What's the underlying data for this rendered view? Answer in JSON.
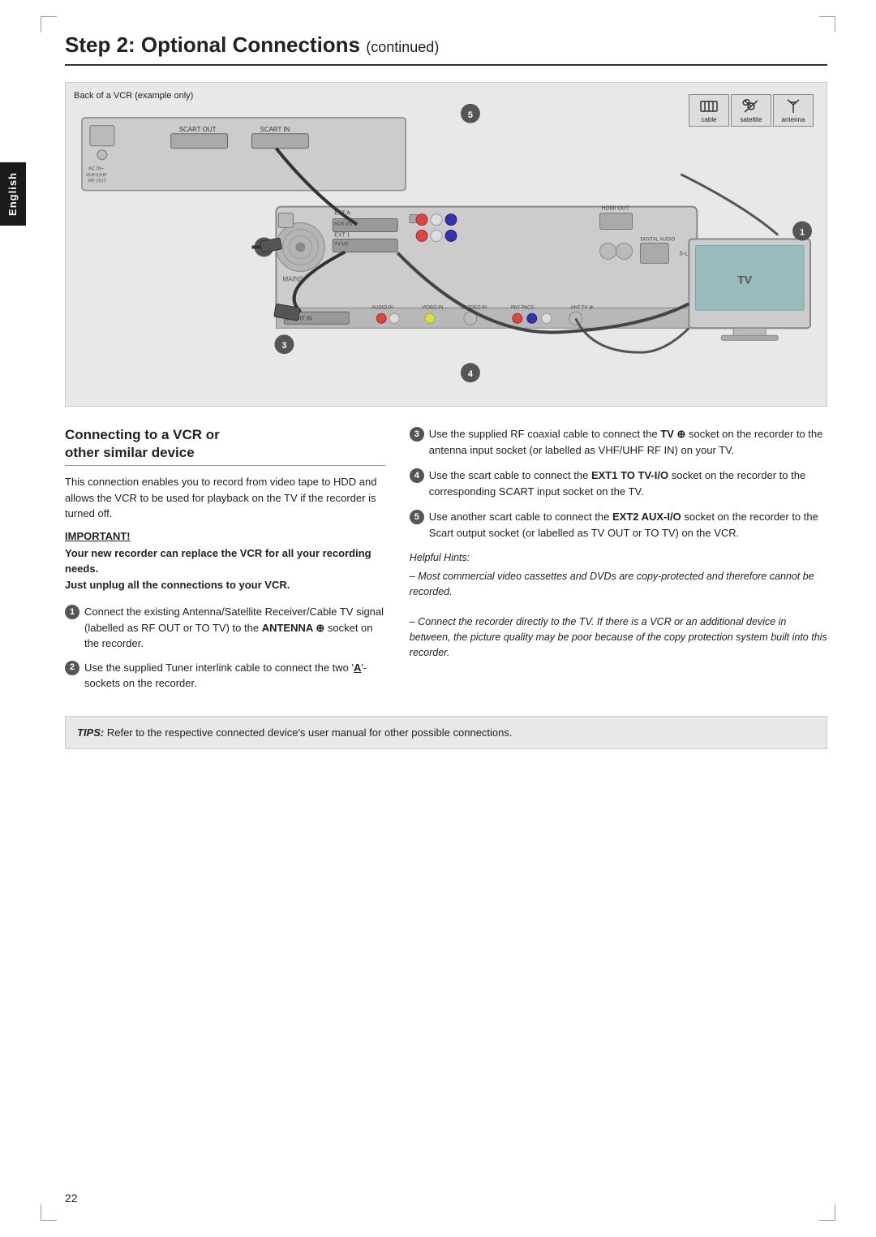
{
  "page": {
    "number": "22",
    "title": "Step 2: Optional Connections",
    "title_continued": "continued"
  },
  "english_tab": "English",
  "diagram": {
    "label": "Back of a VCR (example only)",
    "step_numbers": [
      "1",
      "2",
      "3",
      "4",
      "5"
    ],
    "icon_labels": [
      "cable",
      "satellite",
      "antenna"
    ]
  },
  "section": {
    "heading_line1": "Connecting to a VCR or",
    "heading_line2": "other similar device",
    "intro_text": "This connection enables you to record from video tape to HDD and allows the VCR to be used for playback on the TV if the recorder is turned off.",
    "important_label": "IMPORTANT!",
    "important_bold1": "Your new recorder can replace the VCR for all your recording needs.",
    "important_bold2": "Just unplug all the connections to your VCR.",
    "left_list": [
      {
        "number": "1",
        "text_before": "Connect the existing Antenna/Satellite Receiver/Cable TV signal (labelled as RF OUT or TO TV) to the ",
        "bold": "ANTENNA ⊕",
        "text_after": " socket on the recorder."
      },
      {
        "number": "2",
        "text_before": "Use the supplied Tuner interlink cable to connect the two '",
        "bold_char": "A",
        "text_after": "'-sockets on the recorder."
      }
    ],
    "right_list": [
      {
        "number": "3",
        "text": "Use the supplied RF coaxial cable to connect the ",
        "bold": "TV ⊕",
        "text2": " socket on the recorder to the antenna input socket (or labelled as VHF/UHF RF IN) on your TV."
      },
      {
        "number": "4",
        "text": "Use the scart cable to connect the ",
        "bold": "EXT1 TO TV-I/O",
        "text2": " socket on the recorder to the corresponding SCART input socket on the TV."
      },
      {
        "number": "5",
        "text": "Use another scart cable to connect the ",
        "bold": "EXT2 AUX-I/O",
        "text2": " socket on the recorder to the Scart output socket (or labelled as TV OUT or TO TV) on the VCR."
      }
    ],
    "helpful_hints_title": "Helpful Hints:",
    "hint1": "– Most commercial video cassettes and DVDs are copy-protected and therefore cannot be recorded.",
    "hint2": "– Connect the recorder directly to the TV. If there is a VCR or an additional device in between, the picture quality may be poor because of the copy protection system built into this recorder."
  },
  "tips": {
    "label": "TIPS:",
    "text": "Refer to the respective connected device's user manual for other possible connections."
  }
}
